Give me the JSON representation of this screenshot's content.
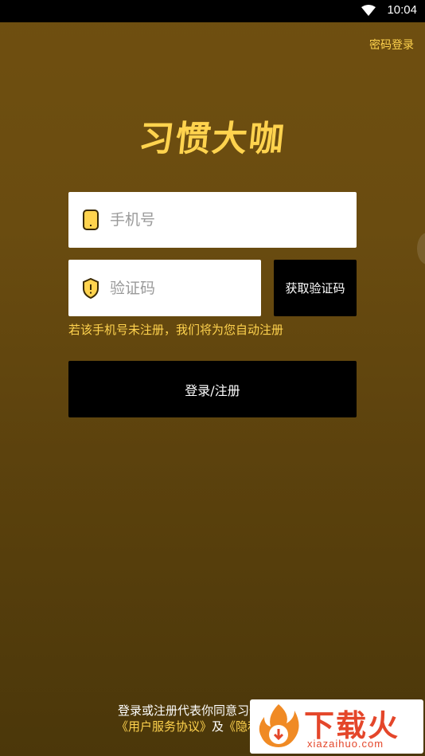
{
  "status_bar": {
    "time": "10:04",
    "wifi_icon": "wifi-icon"
  },
  "header": {
    "password_login": "密码登录"
  },
  "logo": {
    "text": "习惯大咖"
  },
  "form": {
    "phone": {
      "placeholder": "手机号",
      "value": "",
      "icon": "phone-icon"
    },
    "code": {
      "placeholder": "验证码",
      "value": "",
      "icon": "shield-icon"
    },
    "get_code_label": "获取验证码",
    "hint": "若该手机号未注册，我们将为您自动注册",
    "login_label": "登录/注册"
  },
  "agreement": {
    "line1": "登录或注册代表你同意习惯大咖",
    "user_agreement": "《用户服务协议》",
    "and": "及",
    "privacy_policy": "《隐私政策》"
  },
  "watermark": {
    "text": "下载火",
    "domain": "xiazaihuo.com"
  },
  "colors": {
    "accent": "#ffd34e",
    "background": "#6a4c10",
    "button": "#000000"
  }
}
